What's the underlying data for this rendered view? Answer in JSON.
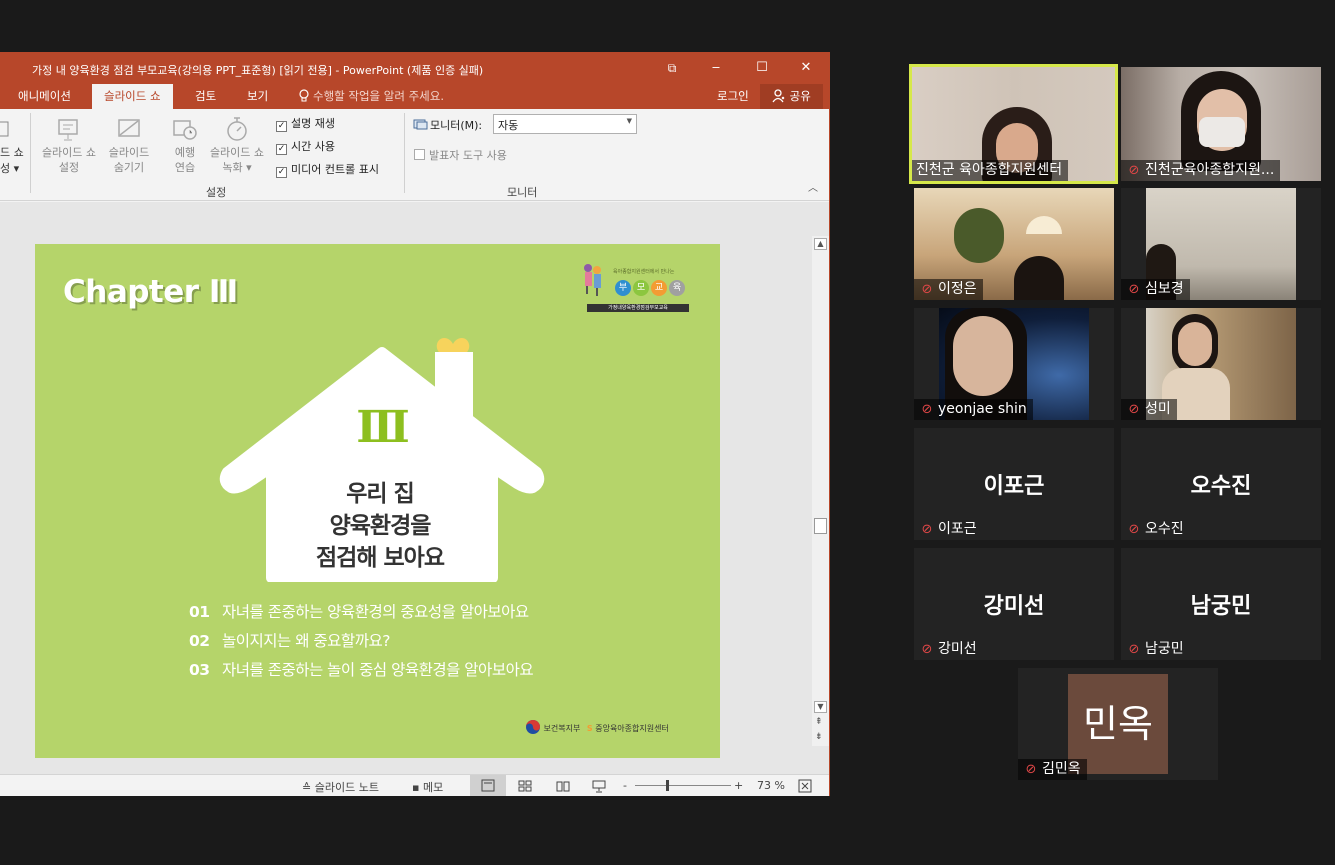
{
  "ppt": {
    "title": "가정 내 양육환경 점검 부모교육(강의용 PPT_표준형) [읽기 전용] - PowerPoint (제품 인증 실패)",
    "controls": {
      "restore": "⧉",
      "minimize": "‒",
      "maximize": "☐",
      "close": "✕"
    },
    "tabs": [
      "애니메이션",
      "슬라이드 쇼",
      "검토",
      "보기"
    ],
    "tell_me": "수행할 작업을 알려 주세요.",
    "login": "로그인",
    "share": "공유",
    "ribbon": {
      "partial_label_1": "드 쇼",
      "partial_label_2": "성 ▾",
      "btn_setup": [
        "슬라이드 쇼",
        "설정"
      ],
      "btn_hide": [
        "슬라이드",
        "숨기기"
      ],
      "btn_rehearse": [
        "예행",
        "연습"
      ],
      "btn_record": [
        "슬라이드 쇼",
        "녹화 ▾"
      ],
      "chk_narration": "설명 재생",
      "chk_timing": "시간 사용",
      "chk_media": "미디어 컨트롤 표시",
      "group_setup": "설정",
      "monitor_label": "모니터(M):",
      "monitor_value": "자동",
      "presenter_view": "발표자 도구 사용",
      "group_monitor": "모니터"
    },
    "slide": {
      "chapter": "Chapter Ⅲ",
      "roman": "Ⅲ",
      "house_lines": [
        "우리 집",
        "양육환경을",
        "점검해 보아요"
      ],
      "items": [
        {
          "num": "01",
          "text": "자녀를 존중하는 양육환경의 중요성을 알아보아요"
        },
        {
          "num": "02",
          "text": "놀이지지는 왜 중요할까요?"
        },
        {
          "num": "03",
          "text": "자녀를 존중하는 놀이 중심 양육환경을 알아보아요"
        }
      ],
      "logo_top_line1": "육아종합지원센터에서 만나는",
      "logo_top_chars": [
        "부",
        "모",
        "교",
        "육"
      ],
      "logo_top_line2": "가정내양육환경점검부모교육",
      "logo_bottom_1": "보건복지부",
      "logo_bottom_2": "중앙육아종합지원센터"
    },
    "status": {
      "notes": "슬라이드 노트",
      "comments": "메모",
      "zoom": "73 %"
    }
  },
  "participants": [
    {
      "name": "진천군 육아종합지원센터",
      "muted": false,
      "video": true,
      "active": true
    },
    {
      "name": "진천군육아종합지원...",
      "muted": true,
      "video": true
    },
    {
      "name": "이정은",
      "muted": true,
      "video": true
    },
    {
      "name": "심보경",
      "muted": true,
      "video": true
    },
    {
      "name": "yeonjae shin",
      "muted": true,
      "video": true
    },
    {
      "name": "성미",
      "muted": true,
      "video": true
    },
    {
      "name": "이포근",
      "muted": true,
      "video": false,
      "display": "이포근"
    },
    {
      "name": "오수진",
      "muted": true,
      "video": false,
      "display": "오수진"
    },
    {
      "name": "강미선",
      "muted": true,
      "video": false,
      "display": "강미선"
    },
    {
      "name": "남궁민",
      "muted": true,
      "video": false,
      "display": "남궁민"
    },
    {
      "name": "김민옥",
      "muted": true,
      "video": false,
      "display": "민옥"
    }
  ],
  "colors": {
    "ppt_accent": "#b7472a",
    "slide_bg": "#b5d46a",
    "active_speaker": "#d6e84a",
    "mute_icon": "#e04747",
    "avatar_bg": "#6b4a3c"
  }
}
